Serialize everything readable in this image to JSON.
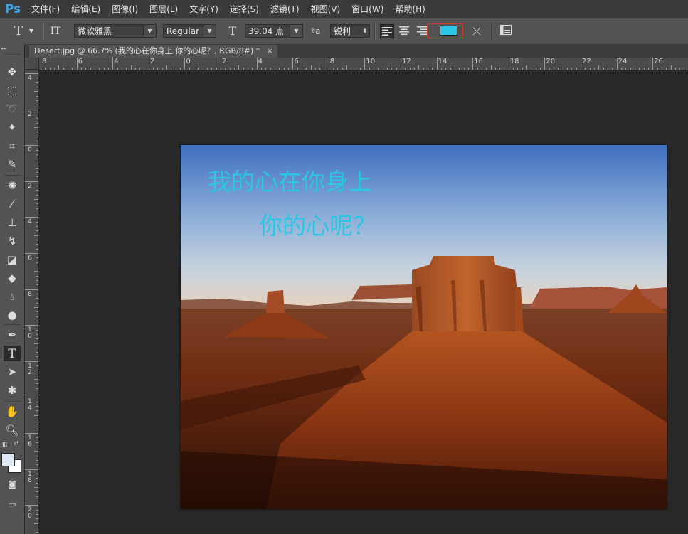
{
  "app": {
    "logo_text": "Ps"
  },
  "menu": [
    "文件(F)",
    "编辑(E)",
    "图像(I)",
    "图层(L)",
    "文字(Y)",
    "选择(S)",
    "滤镜(T)",
    "视图(V)",
    "窗口(W)",
    "帮助(H)"
  ],
  "options": {
    "tool_glyph": "T",
    "orient_glyph": "IT",
    "font_family": "微软雅黑",
    "font_style": "Regular",
    "size_glyph": "T",
    "font_size": "39.04 点",
    "aa_glyph": "ªa",
    "antialias": "锐利",
    "text_color": "#29c7e3",
    "highlight_border": "#d23a2a"
  },
  "document": {
    "tab_title": "Desert.jpg @ 66.7% (我的心在你身上      你的心呢？, RGB/8#) *",
    "close_glyph": "×"
  },
  "ruler_top_labels": [
    "8",
    "6",
    "4",
    "2",
    "0",
    "2",
    "4",
    "6",
    "8",
    "10",
    "12",
    "14",
    "16",
    "18",
    "20",
    "22",
    "24",
    "26"
  ],
  "ruler_left_labels": [
    "4",
    "2",
    "0",
    "2",
    "4",
    "6",
    "8",
    "10",
    "12",
    "14",
    "16",
    "18",
    "20"
  ],
  "canvas": {
    "text_line1": "我的心在你身上",
    "text_line2": "你的心呢？",
    "text_color": "#29c7e3"
  }
}
